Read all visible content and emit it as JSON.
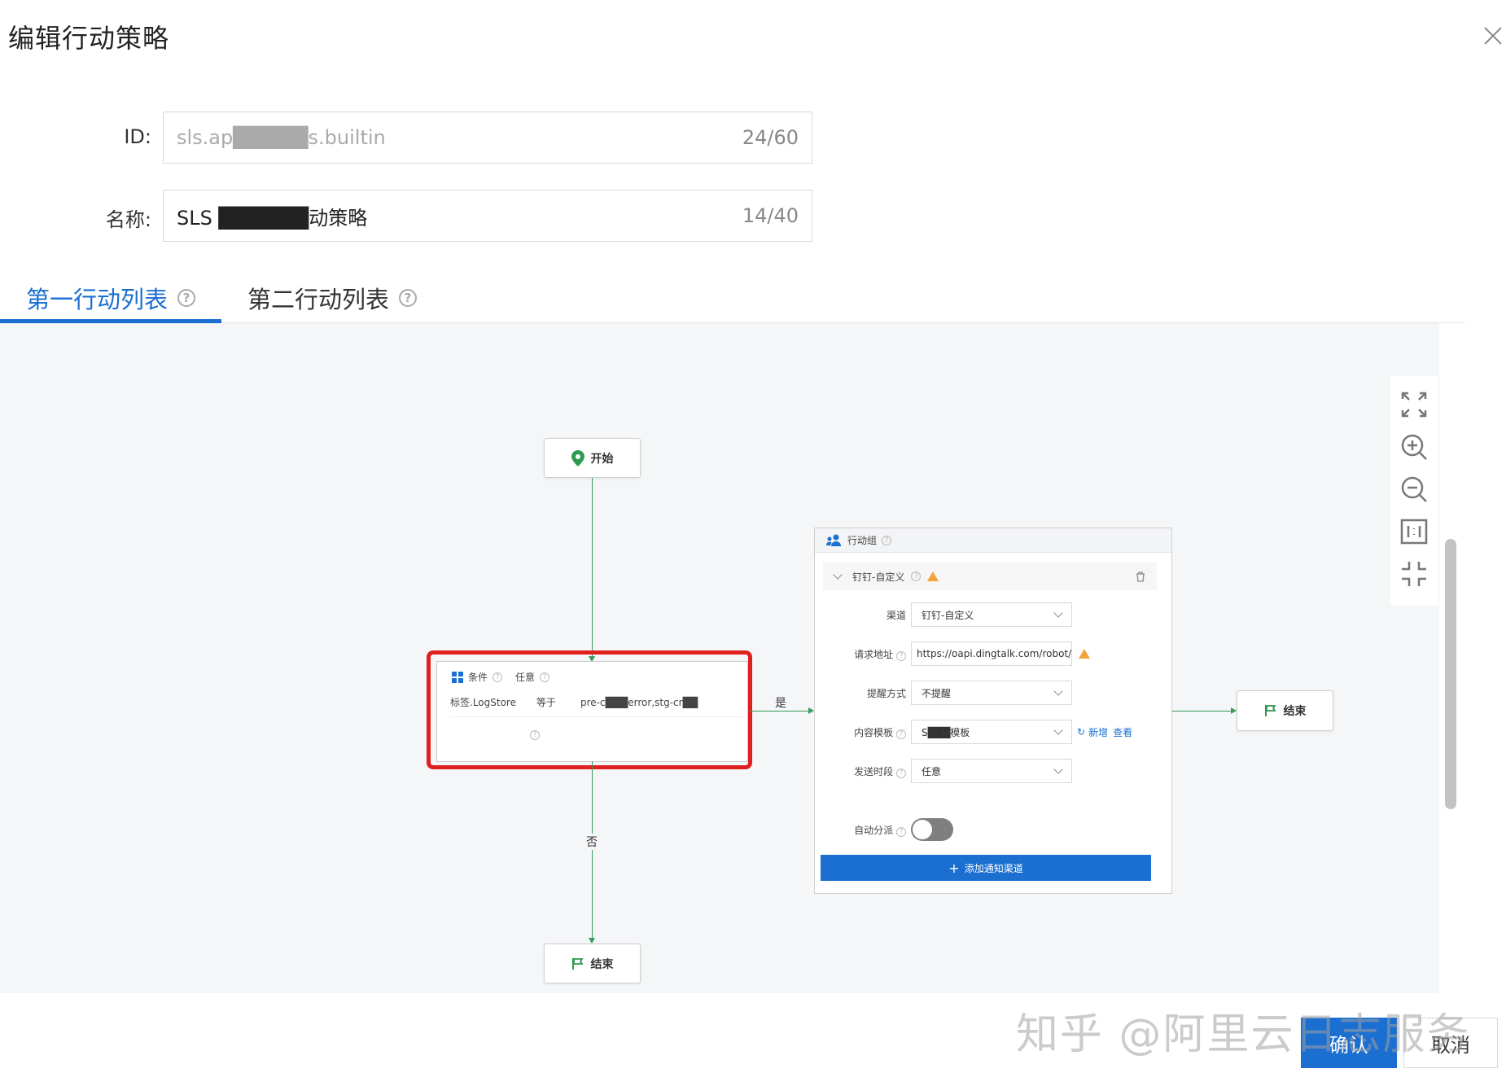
{
  "dialog": {
    "title": "编辑行动策略"
  },
  "form": {
    "id_label": "ID:",
    "id_value": "sls.ap█████s.builtin",
    "id_count": "24/60",
    "name_label": "名称:",
    "name_value": "SLS ██████动策略",
    "name_count": "14/40"
  },
  "tabs": [
    {
      "label": "第一行动列表",
      "active": true
    },
    {
      "label": "第二行动列表",
      "active": false
    }
  ],
  "flow": {
    "start_label": "开始",
    "end_label": "结束",
    "yes_label": "是",
    "no_label": "否",
    "condition": {
      "title": "条件",
      "mode": "任意",
      "field": "标签.LogStore",
      "op": "等于",
      "value": "pre-c███error,stg-cr██"
    },
    "action_group": {
      "title": "行动组",
      "channel_header": "钉钉-自定义",
      "rows": [
        {
          "label": "渠道",
          "value": "钉钉-自定义"
        },
        {
          "label": "请求地址",
          "value": "https://oapi.dingtalk.com/robot/s"
        },
        {
          "label": "提醒方式",
          "value": "不提醒"
        },
        {
          "label": "内容模板",
          "value": "S███模板"
        },
        {
          "label": "发送时段",
          "value": "任意"
        }
      ],
      "template_add": "新增",
      "template_view": "查看",
      "auto_dispatch_label": "自动分派",
      "auto_dispatch_on": false,
      "add_channel": "添加通知渠道"
    }
  },
  "footer": {
    "confirm": "确认",
    "cancel": "取消"
  },
  "watermark": "知乎 @阿里云日志服务",
  "colors": {
    "accent": "#1a6fd0",
    "highlight": "#e02020",
    "edge": "#3a9a5b"
  }
}
